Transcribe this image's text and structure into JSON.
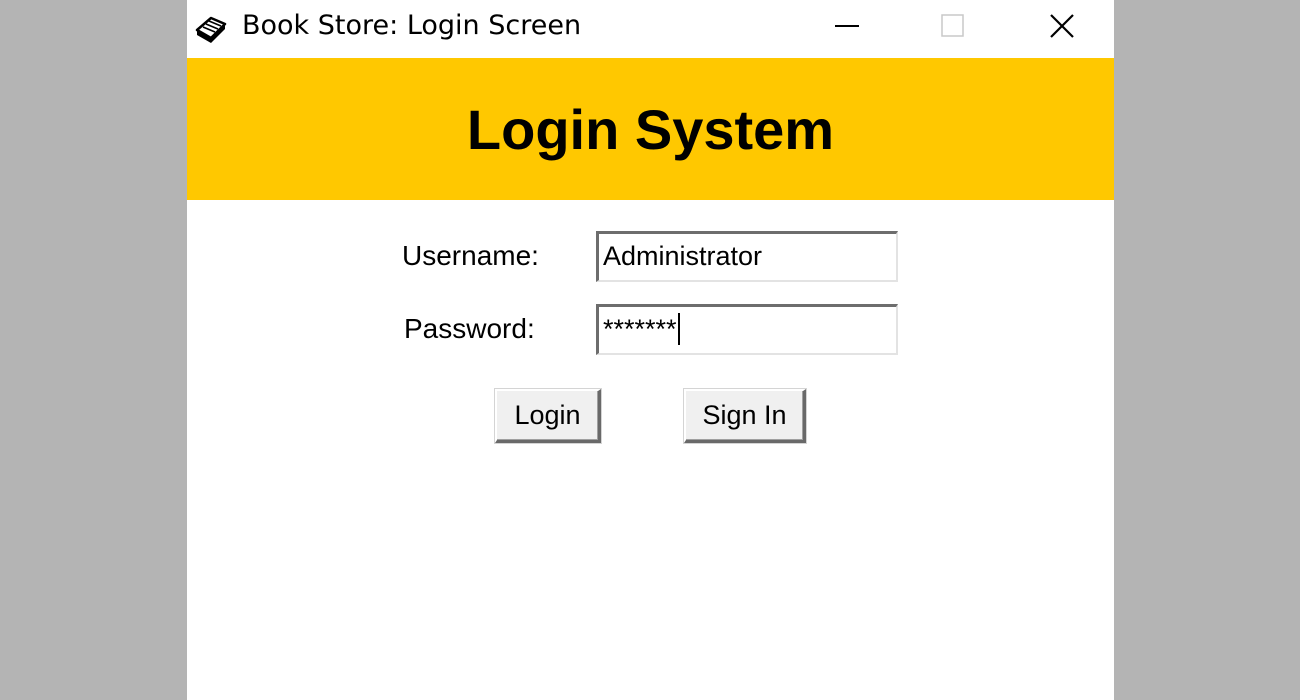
{
  "window": {
    "title": "Book Store: Login Screen",
    "app_icon": "book-icon",
    "controls": [
      "minimize-icon",
      "maximize-icon",
      "close-icon"
    ]
  },
  "header": {
    "title": "Login System",
    "background_color": "#ffc800"
  },
  "form": {
    "username_label": "Username:",
    "username_value": "Administrator",
    "password_label": "Password:",
    "password_value": "*******"
  },
  "buttons": {
    "login_label": "Login",
    "signin_label": "Sign In"
  },
  "colors": {
    "desktop_background": "#b4b4b4",
    "window_background": "#ffffff",
    "accent": "#ffc800"
  }
}
